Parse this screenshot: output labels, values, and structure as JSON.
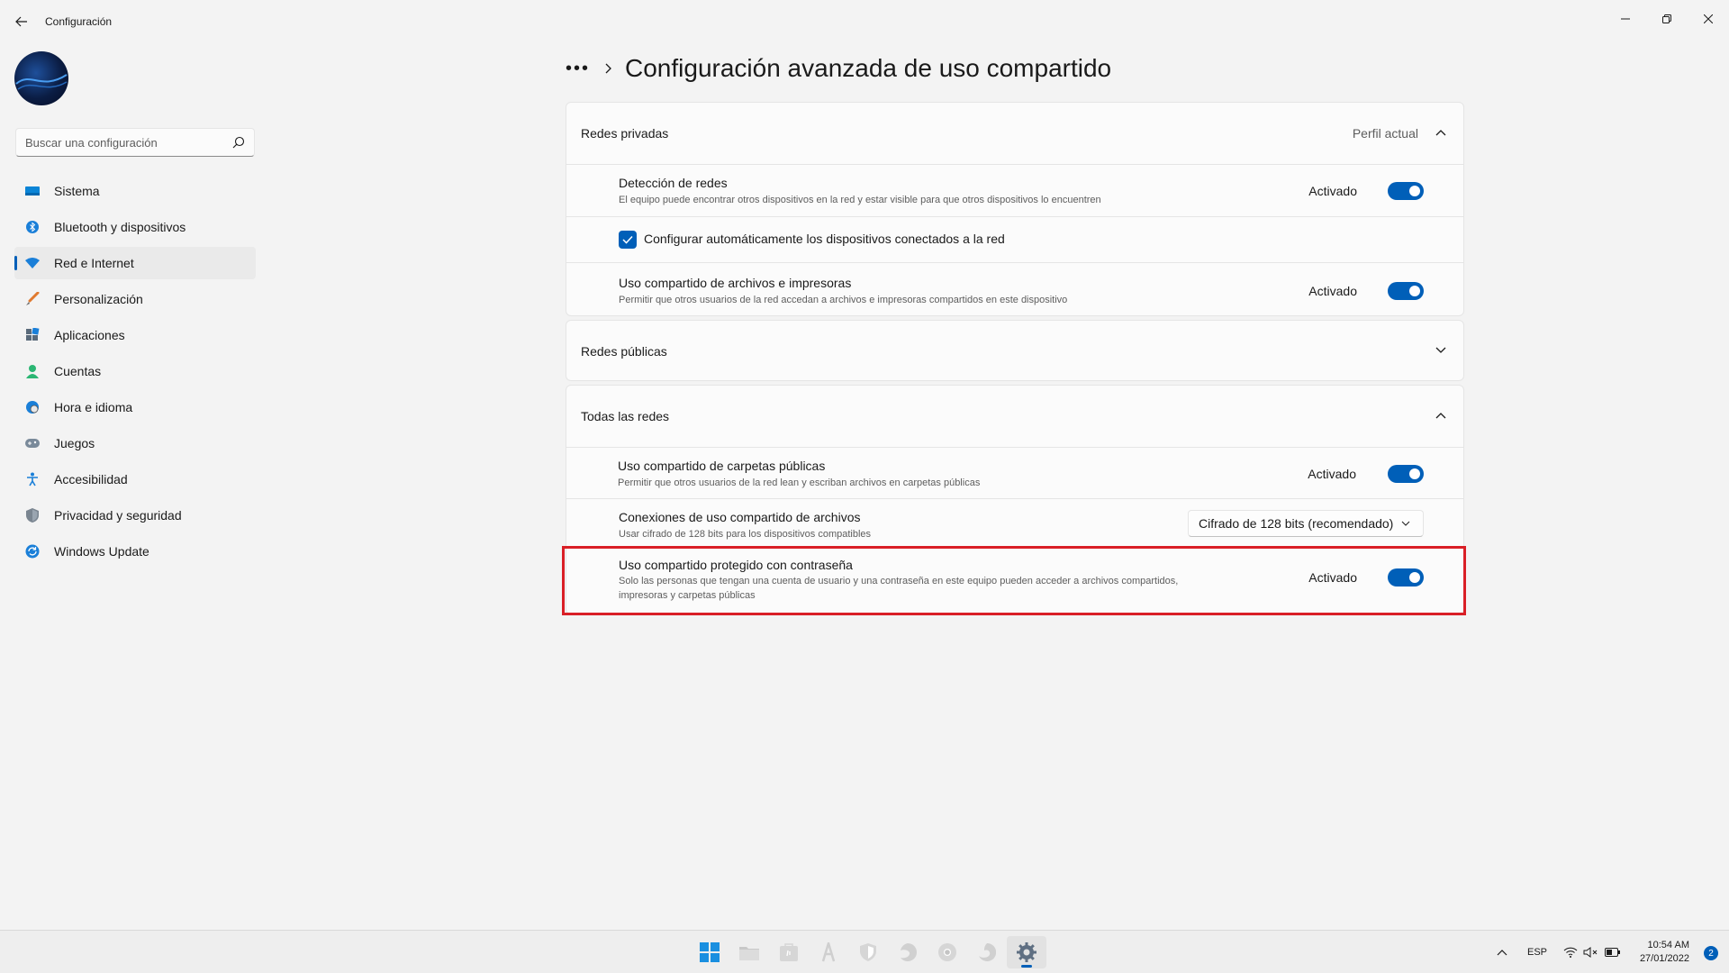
{
  "window": {
    "title": "Configuración",
    "back_icon": "back-arrow-icon",
    "controls": [
      "minimize-icon",
      "restore-icon",
      "close-icon"
    ]
  },
  "search": {
    "placeholder": "Buscar una configuración",
    "icon": "search-icon"
  },
  "sidebar": {
    "items": [
      {
        "label": "Sistema",
        "icon": "monitor-icon",
        "active": false
      },
      {
        "label": "Bluetooth y dispositivos",
        "icon": "bluetooth-icon",
        "active": false
      },
      {
        "label": "Red e Internet",
        "icon": "wifi-icon",
        "active": true
      },
      {
        "label": "Personalización",
        "icon": "brush-icon",
        "active": false
      },
      {
        "label": "Aplicaciones",
        "icon": "apps-icon",
        "active": false
      },
      {
        "label": "Cuentas",
        "icon": "person-icon",
        "active": false
      },
      {
        "label": "Hora e idioma",
        "icon": "globe-clock-icon",
        "active": false
      },
      {
        "label": "Juegos",
        "icon": "gamepad-icon",
        "active": false
      },
      {
        "label": "Accesibilidad",
        "icon": "accessibility-icon",
        "active": false
      },
      {
        "label": "Privacidad y seguridad",
        "icon": "shield-icon",
        "active": false
      },
      {
        "label": "Windows Update",
        "icon": "update-icon",
        "active": false
      }
    ]
  },
  "breadcrumb": {
    "overflow": "•••",
    "title": "Configuración avanzada de uso compartido"
  },
  "sections": {
    "private": {
      "header": "Redes privadas",
      "badge": "Perfil actual",
      "network_discovery": {
        "title": "Detección de redes",
        "desc": "El equipo puede encontrar otros dispositivos en la red y estar visible para que otros dispositivos lo encuentren",
        "status": "Activado",
        "on": true
      },
      "auto_config": {
        "label": "Configurar automáticamente los dispositivos conectados a la red",
        "checked": true
      },
      "file_printer": {
        "title": "Uso compartido de archivos e impresoras",
        "desc": "Permitir que otros usuarios de la red accedan a archivos e impresoras compartidos en este dispositivo",
        "status": "Activado",
        "on": true
      }
    },
    "public": {
      "header": "Redes públicas"
    },
    "all": {
      "header": "Todas las redes",
      "public_folders": {
        "title": "Uso compartido de carpetas públicas",
        "desc": "Permitir que otros usuarios de la red lean y escriban archivos en carpetas públicas",
        "status": "Activado",
        "on": true
      },
      "file_connections": {
        "title": "Conexiones de uso compartido de archivos",
        "desc": "Usar cifrado de 128 bits para los dispositivos compatibles",
        "selected": "Cifrado de 128 bits (recomendado)"
      },
      "password_protected": {
        "title": "Uso compartido protegido con contraseña",
        "desc_line1": "Solo las personas que tengan una cuenta de usuario y una contraseña en este equipo pueden acceder a archivos compartidos,",
        "desc_line2": "impresoras y carpetas públicas",
        "status": "Activado",
        "on": true
      }
    }
  },
  "taskbar": {
    "apps": [
      "start-icon",
      "file-explorer-icon",
      "store-icon",
      "font-app-icon",
      "defender-icon",
      "edge-dev-icon",
      "chrome-icon",
      "edge-icon",
      "settings-icon"
    ],
    "active_app": "settings-icon",
    "lang": "ESP",
    "time": "10:54 AM",
    "date": "27/01/2022",
    "notifications": "2"
  },
  "colors": {
    "accent": "#005fb8",
    "highlight": "#d91f26",
    "background": "#f3f3f3",
    "card": "#fbfbfb"
  }
}
